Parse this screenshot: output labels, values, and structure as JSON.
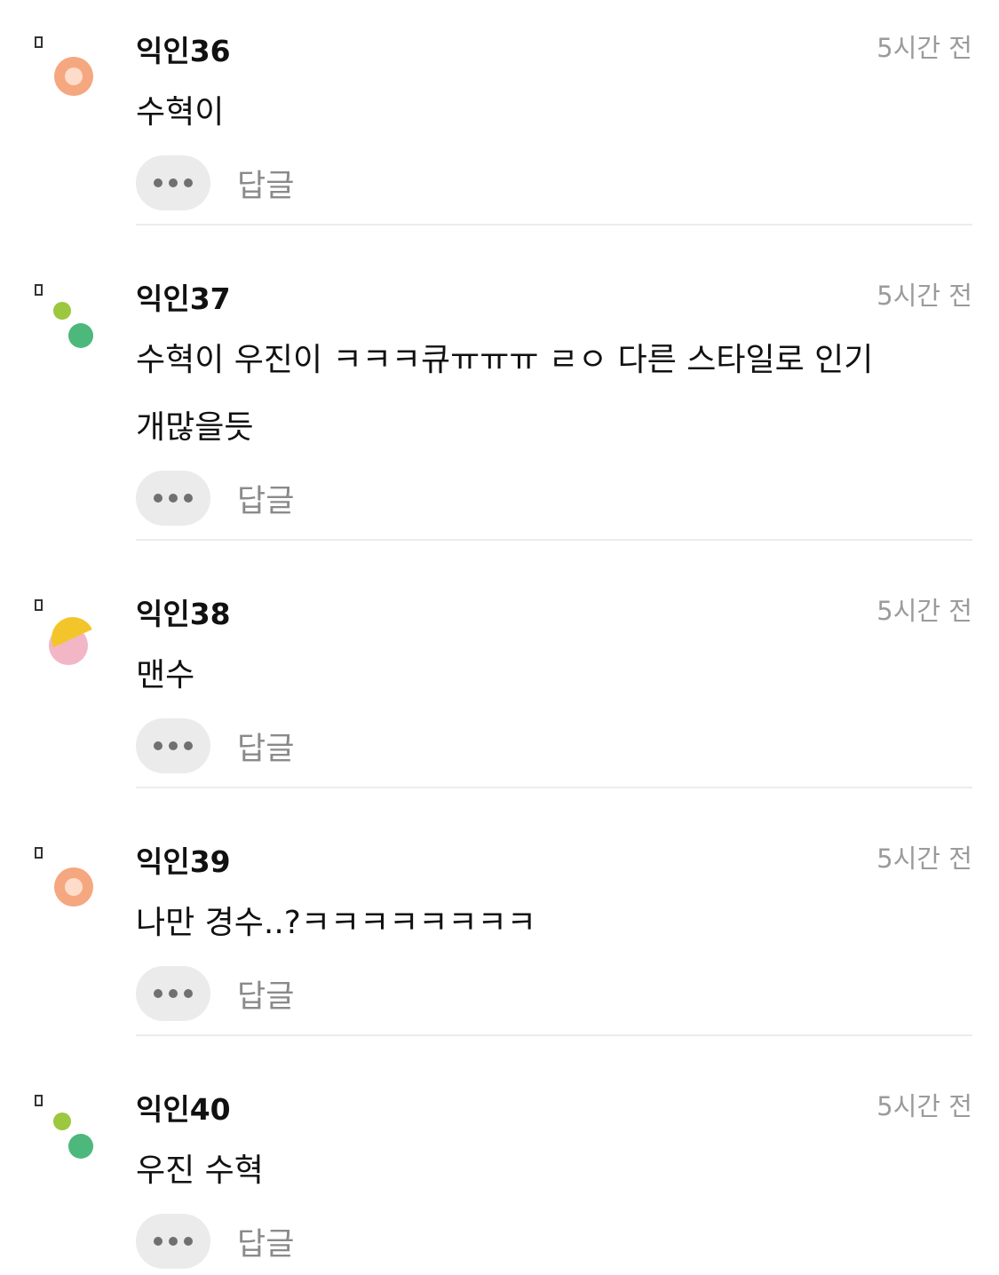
{
  "comments": [
    {
      "author": "익인36",
      "time": "5시간 전",
      "text": "수혁이",
      "avatar": "orange-ring",
      "reply_label": "답글"
    },
    {
      "author": "익인37",
      "time": "5시간 전",
      "text": "수혁이 우진이 ㅋㅋㅋ큐ㅠㅠㅠ ㄹㅇ 다른 스타일로 인기 개많을듯",
      "avatar": "green-dots",
      "reply_label": "답글"
    },
    {
      "author": "익인38",
      "time": "5시간 전",
      "text": "맨수",
      "avatar": "yellow-pink",
      "reply_label": "답글"
    },
    {
      "author": "익인39",
      "time": "5시간 전",
      "text": "나만 경수..?ㅋㅋㅋㅋㅋㅋㅋㅋ",
      "avatar": "orange-ring",
      "reply_label": "답글"
    },
    {
      "author": "익인40",
      "time": "5시간 전",
      "text": "우진 수혁",
      "avatar": "green-dots",
      "reply_label": "답글"
    }
  ],
  "colors": {
    "text": "#111111",
    "time": "#9b9b9b",
    "reply": "#8a8a8a",
    "more_button_bg": "#ebebeb",
    "more_dots": "#707070",
    "separator": "#ececec",
    "avatars": {
      "orange-ring": [
        "#F5A77F",
        "#FDDCC9"
      ],
      "green-dots": [
        "#9CC73F",
        "#4DB87C"
      ],
      "yellow-pink": [
        "#F2C62A",
        "#F2B6C6"
      ]
    }
  }
}
